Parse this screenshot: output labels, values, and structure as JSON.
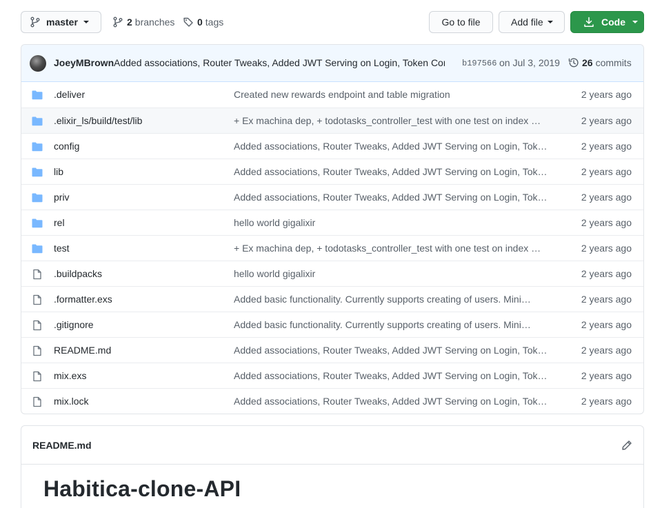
{
  "toolbar": {
    "branch_label": "master",
    "branches_count": "2",
    "branches_label": "branches",
    "tags_count": "0",
    "tags_label": "tags",
    "go_to_file_label": "Go to file",
    "add_file_label": "Add file",
    "code_label": "Code"
  },
  "commit": {
    "author": "JoeyMBrown",
    "message": "Added associations, Router Tweaks, Added JWT Serving on Login, Token Con",
    "sha": "b197566",
    "date": "on Jul 3, 2019",
    "count": "26",
    "count_label": "commits"
  },
  "files": [
    {
      "type": "folder",
      "name": ".deliver",
      "message": "Created new rewards endpoint and table migration",
      "age": "2 years ago"
    },
    {
      "type": "folder",
      "name": ".elixir_ls/build/test/lib",
      "message": "+ Ex machina dep, + todotasks_controller_test with one test on index …",
      "age": "2 years ago"
    },
    {
      "type": "folder",
      "name": "config",
      "message": "Added associations, Router Tweaks, Added JWT Serving on Login, Token …",
      "age": "2 years ago"
    },
    {
      "type": "folder",
      "name": "lib",
      "message": "Added associations, Router Tweaks, Added JWT Serving on Login, Token …",
      "age": "2 years ago"
    },
    {
      "type": "folder",
      "name": "priv",
      "message": "Added associations, Router Tweaks, Added JWT Serving on Login, Token …",
      "age": "2 years ago"
    },
    {
      "type": "folder",
      "name": "rel",
      "message": "hello world gigalixir",
      "age": "2 years ago"
    },
    {
      "type": "folder",
      "name": "test",
      "message": "+ Ex machina dep, + todotasks_controller_test with one test on index …",
      "age": "2 years ago"
    },
    {
      "type": "file",
      "name": ".buildpacks",
      "message": "hello world gigalixir",
      "age": "2 years ago"
    },
    {
      "type": "file",
      "name": ".formatter.exs",
      "message": "Added basic functionality. Currently supports creating of users. Mini…",
      "age": "2 years ago"
    },
    {
      "type": "file",
      "name": ".gitignore",
      "message": "Added basic functionality. Currently supports creating of users. Mini…",
      "age": "2 years ago"
    },
    {
      "type": "file",
      "name": "README.md",
      "message": "Added associations, Router Tweaks, Added JWT Serving on Login, Token …",
      "age": "2 years ago"
    },
    {
      "type": "file",
      "name": "mix.exs",
      "message": "Added associations, Router Tweaks, Added JWT Serving on Login, Token …",
      "age": "2 years ago"
    },
    {
      "type": "file",
      "name": "mix.lock",
      "message": "Added associations, Router Tweaks, Added JWT Serving on Login, Token …",
      "age": "2 years ago"
    }
  ],
  "readme": {
    "filename": "README.md",
    "heading": "Habitica-clone-API"
  },
  "colors": {
    "folder_icon": "#79b8ff",
    "file_icon": "#6a737d",
    "code_button": "#2c974b",
    "commit_bar": "#f1f8ff"
  }
}
